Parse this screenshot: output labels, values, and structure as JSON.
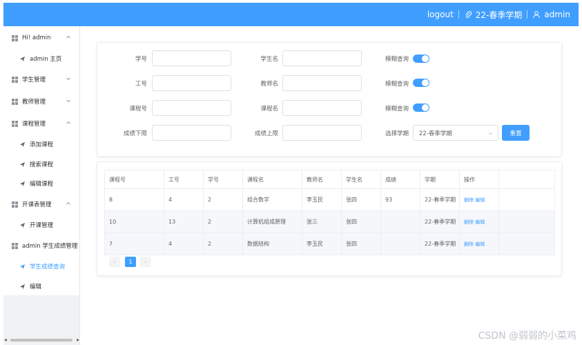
{
  "header": {
    "logout_label": "logout",
    "semester_label": "22-春季学期",
    "user_label": "admin"
  },
  "sidebar": {
    "items": [
      {
        "label": "Hi! admin",
        "type": "group",
        "expanded": true
      },
      {
        "label": "admin 主页",
        "type": "sub"
      },
      {
        "label": "学生管理",
        "type": "group",
        "expanded": false
      },
      {
        "label": "教师管理",
        "type": "group",
        "expanded": false
      },
      {
        "label": "课程管理",
        "type": "group",
        "expanded": true
      },
      {
        "label": "添加课程",
        "type": "sub"
      },
      {
        "label": "搜索课程",
        "type": "sub"
      },
      {
        "label": "编辑课程",
        "type": "sub"
      },
      {
        "label": "开课表管理",
        "type": "group",
        "expanded": true
      },
      {
        "label": "开课管理",
        "type": "sub"
      },
      {
        "label": "admin 学生成绩管理",
        "type": "group",
        "expanded": true
      },
      {
        "label": "学生成绩查询",
        "type": "sub",
        "active": true
      },
      {
        "label": "编辑",
        "type": "sub"
      }
    ]
  },
  "form": {
    "student_id_label": "学号",
    "student_name_label": "学生名",
    "fuzzy_label_1": "模糊查询",
    "teacher_id_label": "工号",
    "teacher_name_label": "教师名",
    "fuzzy_label_2": "模糊查询",
    "course_id_label": "课程号",
    "course_name_label": "课程名",
    "fuzzy_label_3": "模糊查询",
    "score_min_label": "成绩下限",
    "score_max_label": "成绩上限",
    "semester_select_label": "选择学期",
    "semester_select_value": "22-春季学期",
    "reset_label": "重置"
  },
  "table": {
    "headers": [
      "课程号",
      "工号",
      "学号",
      "课程名",
      "教师名",
      "学生名",
      "成绩",
      "学期",
      "操作"
    ],
    "rows": [
      {
        "course_id": "8",
        "teacher_id": "4",
        "student_id": "2",
        "course_name": "组合数学",
        "teacher_name": "李玉民",
        "student_name": "张四",
        "score": "93",
        "semester": "22-春季学期",
        "delete": "删除",
        "edit": "编辑"
      },
      {
        "course_id": "10",
        "teacher_id": "13",
        "student_id": "2",
        "course_name": "计算机组成原理",
        "teacher_name": "张三",
        "student_name": "张四",
        "score": "",
        "semester": "22-春季学期",
        "delete": "删除",
        "edit": "编辑"
      },
      {
        "course_id": "7",
        "teacher_id": "4",
        "student_id": "2",
        "course_name": "数据结构",
        "teacher_name": "李玉民",
        "student_name": "张四",
        "score": "",
        "semester": "22-春季学期",
        "delete": "删除",
        "edit": "编辑"
      }
    ]
  },
  "pagination": {
    "current_page": "1"
  },
  "watermark": "CSDN @弱弱的小菜鸡",
  "colors": {
    "primary": "#409eff",
    "border": "#dcdfe6",
    "sidebar_bg": "#ffffff"
  }
}
